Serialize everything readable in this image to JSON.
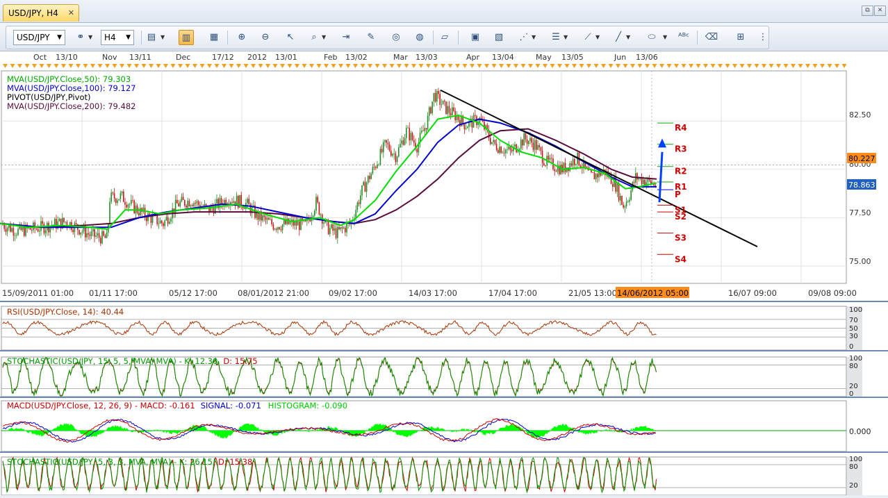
{
  "tab": {
    "title": "USD/JPY, H4",
    "close": "✕"
  },
  "window_buttons": {
    "restore": "⧉",
    "close": "✕"
  },
  "toolbar": {
    "symbol": "USD/JPY",
    "timeframe": "H4"
  },
  "colors": {
    "candle_up": "#228b22",
    "candle_down": "#c81414",
    "mva50": "#00dd00",
    "mva100": "#0000cc",
    "mva200": "#5a0a3a",
    "pivot_red": "#cc0000",
    "rsi": "#aa3300",
    "stoch_k": "#009900",
    "stoch_d": "#cc0000",
    "macd": "#cc0000",
    "signal": "#0000cc",
    "hist": "#00ff00",
    "price_tag_current": "#2060c0",
    "price_tag_hline": "#ff8c1a"
  },
  "chart_data": [
    {
      "type": "candlestick",
      "title": "",
      "instrument": "USD/JPY",
      "timeframe": "H4",
      "top_axis_labels": [
        "Oct",
        "13/10",
        "Nov",
        "13/11",
        "Dec",
        "17/12",
        "2012",
        "13/01",
        "Feb",
        "13/02",
        "Mar",
        "13/03",
        "Apr",
        "13/04",
        "May",
        "13/05",
        "Jun",
        "13/06"
      ],
      "x_tick_labels": [
        "15/09/2011 01:00",
        "01/11 17:00",
        "05/12 17:00",
        "08/01/2012 21:00",
        "09/02 17:00",
        "14/03 17:00",
        "17/04 17:00",
        "21/05 13:00",
        "16/07 09:00",
        "09/08 09:00"
      ],
      "cursor_date_label": "14/06/2012 05:00",
      "y_ticks": [
        75.0,
        77.5,
        80.0,
        82.5
      ],
      "y_tick_labels": [
        "75.00",
        "77.50",
        "80.00",
        "82.50"
      ],
      "ylim": [
        74.1,
        85.1
      ],
      "grid": true,
      "current_price": "78.863",
      "hline_price": "80.227",
      "legend": [
        {
          "text": "MVA(USD/JPY.Close,50): 79.303",
          "color": "#00aa00"
        },
        {
          "text": "MVA(USD/JPY.Close,100): 79.127",
          "color": "#0000cc"
        },
        {
          "text": "PIVOT(USD/JPY,Pivot)",
          "color": "#000000"
        },
        {
          "text": "MVA(USD/JPY.Close,200): 79.482",
          "color": "#5a0a3a"
        }
      ],
      "close_path": [
        [
          0,
          77.2
        ],
        [
          25,
          76.8
        ],
        [
          60,
          77.0
        ],
        [
          95,
          77.3
        ],
        [
          130,
          76.6
        ],
        [
          155,
          76.4
        ],
        [
          157,
          78.5
        ],
        [
          175,
          78.6
        ],
        [
          190,
          78.1
        ],
        [
          210,
          77.6
        ],
        [
          235,
          77.2
        ],
        [
          255,
          78.2
        ],
        [
          275,
          78.4
        ],
        [
          300,
          77.9
        ],
        [
          330,
          78.5
        ],
        [
          355,
          78.2
        ],
        [
          370,
          77.6
        ],
        [
          395,
          77.1
        ],
        [
          420,
          77.2
        ],
        [
          440,
          77.1
        ],
        [
          455,
          78.3
        ],
        [
          470,
          77.0
        ],
        [
          485,
          76.7
        ],
        [
          505,
          77.2
        ],
        [
          520,
          78.8
        ],
        [
          540,
          80.2
        ],
        [
          555,
          81.3
        ],
        [
          570,
          80.7
        ],
        [
          585,
          82.0
        ],
        [
          600,
          81.2
        ],
        [
          615,
          82.5
        ],
        [
          625,
          83.9
        ],
        [
          640,
          83.2
        ],
        [
          655,
          82.8
        ],
        [
          670,
          82.3
        ],
        [
          690,
          82.6
        ],
        [
          710,
          81.3
        ],
        [
          735,
          80.9
        ],
        [
          755,
          81.6
        ],
        [
          770,
          81.3
        ],
        [
          785,
          80.4
        ],
        [
          810,
          80.0
        ],
        [
          830,
          80.6
        ],
        [
          850,
          79.6
        ],
        [
          870,
          79.9
        ],
        [
          885,
          79.3
        ],
        [
          897,
          78.1
        ],
        [
          905,
          78.6
        ],
        [
          915,
          79.6
        ],
        [
          930,
          79.4
        ],
        [
          945,
          79.2
        ]
      ],
      "mva50": [
        [
          0,
          77.2
        ],
        [
          40,
          77.0
        ],
        [
          90,
          77.1
        ],
        [
          130,
          77.0
        ],
        [
          155,
          76.9
        ],
        [
          180,
          77.9
        ],
        [
          200,
          77.9
        ],
        [
          230,
          77.7
        ],
        [
          260,
          77.9
        ],
        [
          300,
          78.0
        ],
        [
          340,
          78.2
        ],
        [
          380,
          77.7
        ],
        [
          420,
          77.3
        ],
        [
          460,
          77.5
        ],
        [
          490,
          77.1
        ],
        [
          510,
          77.4
        ],
        [
          540,
          78.4
        ],
        [
          570,
          79.9
        ],
        [
          600,
          81.2
        ],
        [
          630,
          82.6
        ],
        [
          660,
          82.8
        ],
        [
          690,
          82.4
        ],
        [
          720,
          81.5
        ],
        [
          750,
          80.9
        ],
        [
          780,
          80.6
        ],
        [
          810,
          80.0
        ],
        [
          840,
          80.1
        ],
        [
          870,
          79.8
        ],
        [
          900,
          79.0
        ],
        [
          920,
          79.1
        ],
        [
          945,
          79.3
        ]
      ],
      "mva100": [
        [
          0,
          77.2
        ],
        [
          60,
          77.0
        ],
        [
          120,
          77.0
        ],
        [
          160,
          77.0
        ],
        [
          200,
          77.5
        ],
        [
          240,
          77.8
        ],
        [
          280,
          78.0
        ],
        [
          320,
          78.2
        ],
        [
          360,
          78.1
        ],
        [
          400,
          77.8
        ],
        [
          440,
          77.5
        ],
        [
          480,
          77.3
        ],
        [
          510,
          77.2
        ],
        [
          540,
          77.7
        ],
        [
          570,
          78.9
        ],
        [
          600,
          80.0
        ],
        [
          630,
          81.4
        ],
        [
          660,
          82.3
        ],
        [
          690,
          82.6
        ],
        [
          720,
          82.4
        ],
        [
          760,
          81.9
        ],
        [
          800,
          81.2
        ],
        [
          840,
          80.4
        ],
        [
          880,
          79.6
        ],
        [
          910,
          79.1
        ],
        [
          945,
          79.1
        ]
      ],
      "mva200": [
        [
          0,
          77.2
        ],
        [
          60,
          77.0
        ],
        [
          120,
          77.1
        ],
        [
          160,
          77.2
        ],
        [
          200,
          77.5
        ],
        [
          240,
          77.7
        ],
        [
          280,
          77.8
        ],
        [
          320,
          77.8
        ],
        [
          360,
          77.8
        ],
        [
          400,
          77.7
        ],
        [
          440,
          77.5
        ],
        [
          480,
          77.3
        ],
        [
          510,
          77.2
        ],
        [
          540,
          77.4
        ],
        [
          570,
          77.9
        ],
        [
          600,
          78.6
        ],
        [
          630,
          79.5
        ],
        [
          660,
          80.6
        ],
        [
          690,
          81.5
        ],
        [
          720,
          82.0
        ],
        [
          760,
          82.1
        ],
        [
          800,
          81.5
        ],
        [
          840,
          80.8
        ],
        [
          880,
          80.0
        ],
        [
          910,
          79.6
        ],
        [
          945,
          79.5
        ]
      ],
      "trendline": [
        [
          634,
          84.1
        ],
        [
          1090,
          76.0
        ]
      ],
      "pivot_levels": [
        {
          "label": "R4",
          "value": 82.4
        },
        {
          "label": "R3",
          "value": 81.3
        },
        {
          "label": "R2",
          "value": 80.15
        },
        {
          "label": "R1",
          "value": 79.35
        },
        {
          "label": "P",
          "value": 78.95
        },
        {
          "label": "S1",
          "value": 78.15
        },
        {
          "label": "S2",
          "value": 77.8
        },
        {
          "label": "S3",
          "value": 76.7
        },
        {
          "label": "S4",
          "value": 75.6
        }
      ]
    },
    {
      "type": "line",
      "title": "RSI(USD/JPY.Close, 14): 40.44",
      "ylim": [
        0,
        100
      ],
      "y_tick_labels": [
        "100",
        "70",
        "50",
        "30",
        "0"
      ],
      "levels": [
        70,
        50,
        30
      ],
      "series": [
        {
          "name": "RSI(USD/JPY.Close, 14)",
          "last": 40.44
        }
      ]
    },
    {
      "type": "line",
      "title_k": "STOCHASTIC(USD/JPY, 15, 5, 5, MVA, MVA) - K: 12.30",
      "title_d": "D: 15.75",
      "ylim": [
        0,
        100
      ],
      "y_tick_labels": [
        "100",
        "80",
        "20",
        "0"
      ],
      "levels": [
        80,
        20
      ],
      "series": [
        {
          "name": "K",
          "last": 12.3
        },
        {
          "name": "D",
          "last": 15.75
        }
      ]
    },
    {
      "type": "line",
      "title_macd": "MACD(USD/JPY.Close, 12, 26, 9) - MACD: -0.161",
      "title_signal": "SIGNAL: -0.071",
      "title_hist": "HISTOGRAM: -0.090",
      "y_tick_labels": [
        "0.000"
      ],
      "series": [
        {
          "name": "MACD",
          "last": -0.161
        },
        {
          "name": "SIGNAL",
          "last": -0.071
        },
        {
          "name": "HISTOGRAM",
          "last": -0.09
        }
      ]
    },
    {
      "type": "line",
      "title_k": "STOCHASTIC(USD/JPY, 5, 3, 3, MVA, MVA) - K: 26.15",
      "title_d": "D: 15.38",
      "ylim": [
        0,
        100
      ],
      "y_tick_labels": [
        "100",
        "80",
        "20"
      ],
      "levels": [
        80,
        20
      ],
      "series": [
        {
          "name": "K",
          "last": 26.15
        },
        {
          "name": "D",
          "last": 15.38
        }
      ]
    }
  ]
}
